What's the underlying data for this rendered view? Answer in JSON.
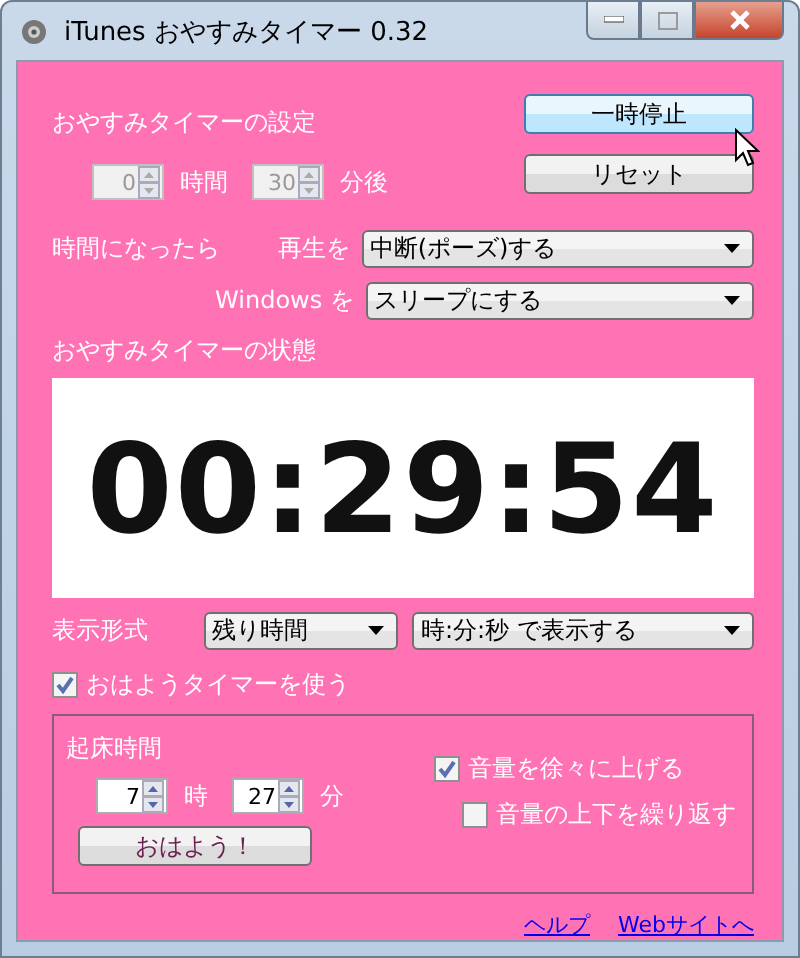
{
  "window": {
    "title": "iTunes おやすみタイマー 0.32"
  },
  "timer_settings": {
    "label": "おやすみタイマーの設定",
    "hours": {
      "value": "0",
      "unit": "時間",
      "disabled": true
    },
    "minutes": {
      "value": "30",
      "unit": "分後",
      "disabled": true
    }
  },
  "buttons": [
    {
      "label": "一時停止",
      "hovered": true
    },
    {
      "label": "リセット",
      "hovered": false
    }
  ],
  "on_timeout": {
    "label": "時間になったら",
    "rows": [
      {
        "label": "再生を",
        "value": "中断(ポーズ)する"
      },
      {
        "label": "Windows を",
        "value": "スリープにする"
      }
    ]
  },
  "status": {
    "label": "おやすみタイマーの状態",
    "time": "00:29:54"
  },
  "display_format": {
    "label": "表示形式",
    "mode": "残り時間",
    "format": "時:分:秒 で表示する"
  },
  "wake_timer": {
    "label": "おはようタイマーを使う",
    "checked": true
  },
  "wake_group": {
    "label": "起床時間",
    "hour": {
      "value": "7",
      "unit": "時",
      "disabled": false
    },
    "minute": {
      "value": "27",
      "unit": "分",
      "disabled": false
    },
    "button": "おはよう！",
    "options": [
      {
        "label": "音量を徐々に上げる",
        "checked": true,
        "indent": false
      },
      {
        "label": "音量の上下を繰り返す",
        "checked": false,
        "indent": true
      }
    ]
  },
  "links": [
    "ヘルプ",
    "Webサイトへ"
  ]
}
